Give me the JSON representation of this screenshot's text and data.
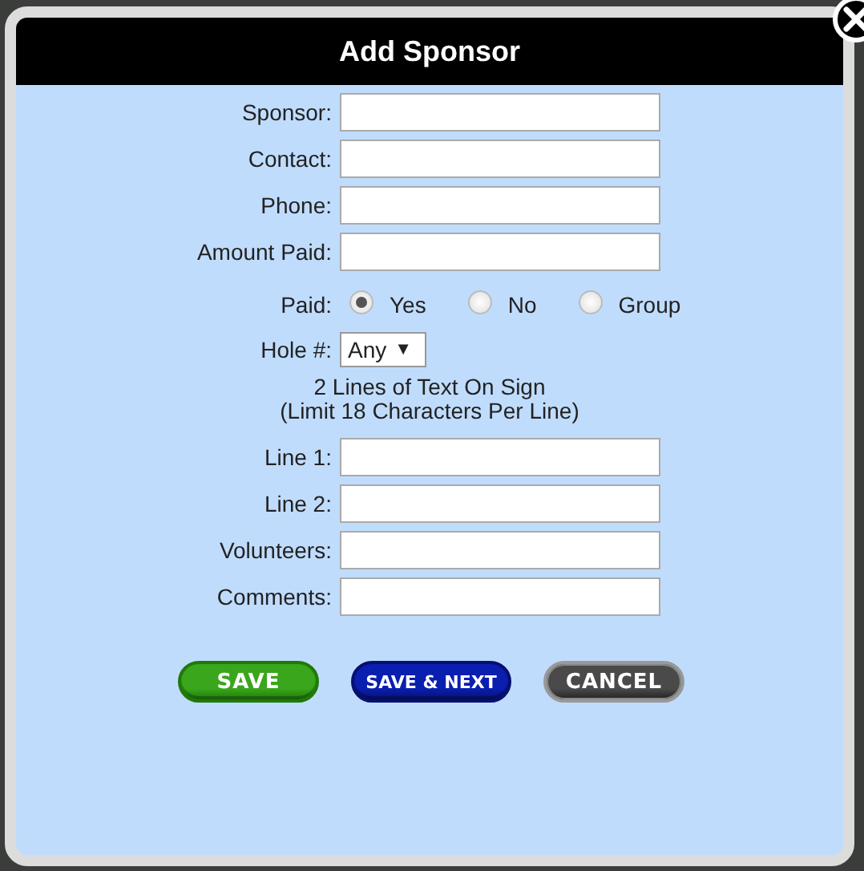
{
  "dialog": {
    "title": "Add Sponsor",
    "fields_top": [
      {
        "label": "Sponsor:"
      },
      {
        "label": "Contact:"
      },
      {
        "label": "Phone:"
      },
      {
        "label": "Amount Paid:"
      }
    ],
    "paid": {
      "label": "Paid:",
      "options": [
        {
          "label": "Yes",
          "selected": true
        },
        {
          "label": "No",
          "selected": false
        },
        {
          "label": "Group",
          "selected": false
        }
      ]
    },
    "hole": {
      "label": "Hole #:",
      "value": "Any",
      "caret": "▼"
    },
    "note": [
      "2 Lines of Text On Sign",
      "(Limit 18 Characters Per Line)"
    ],
    "fields_bottom": [
      {
        "label": "Line 1:"
      },
      {
        "label": "Line 2:"
      },
      {
        "label": "Volunteers:"
      },
      {
        "label": "Comments:"
      }
    ],
    "buttons": [
      {
        "label": "SAVE",
        "kind": "save"
      },
      {
        "label": "SAVE & NEXT",
        "kind": "next"
      },
      {
        "label": "CANCEL",
        "kind": "cancel"
      }
    ]
  }
}
